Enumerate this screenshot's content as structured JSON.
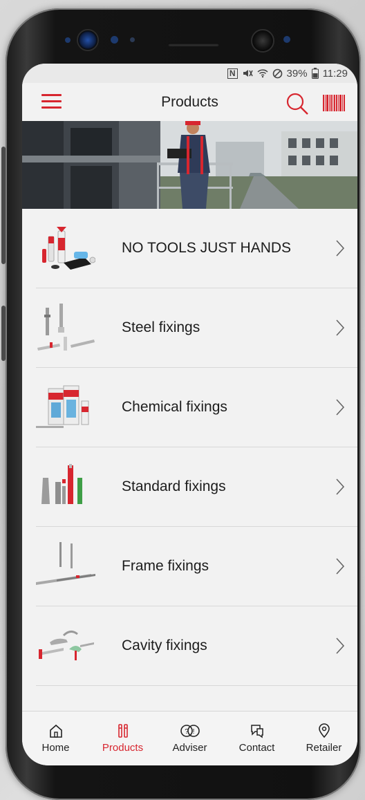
{
  "status": {
    "nfc": "N",
    "battery_percent": "39%",
    "time": "11:29"
  },
  "appbar": {
    "title": "Products"
  },
  "products": [
    {
      "label": "NO TOOLS JUST HANDS"
    },
    {
      "label": "Steel fixings"
    },
    {
      "label": "Chemical fixings"
    },
    {
      "label": "Standard fixings"
    },
    {
      "label": "Frame fixings"
    },
    {
      "label": "Cavity fixings"
    }
  ],
  "bottomnav": {
    "items": [
      {
        "label": "Home",
        "icon": "home-icon"
      },
      {
        "label": "Products",
        "icon": "products-icon",
        "active": true
      },
      {
        "label": "Adviser",
        "icon": "adviser-icon"
      },
      {
        "label": "Contact",
        "icon": "contact-icon"
      },
      {
        "label": "Retailer",
        "icon": "location-pin-icon"
      }
    ]
  },
  "colors": {
    "accent": "#d7262f",
    "background": "#f2f2f2",
    "text": "#1c1c1c"
  }
}
